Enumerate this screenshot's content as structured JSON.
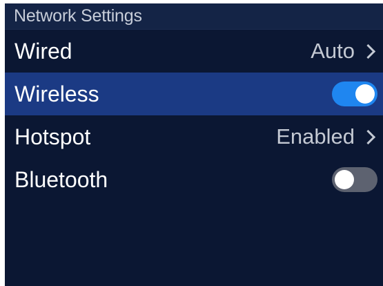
{
  "header": {
    "title": "Network Settings"
  },
  "colors": {
    "background": "#0b1733",
    "header": "#142446",
    "selected": "#1b3a84",
    "toggle_on": "#1f86f0",
    "toggle_off": "#5d6270"
  },
  "menu": {
    "items": [
      {
        "label": "Wired",
        "value": "Auto",
        "control": "chevron-right-icon"
      },
      {
        "label": "Wireless",
        "toggle": "on",
        "selected": true
      },
      {
        "label": "Hotspot",
        "value": "Enabled",
        "control": "chevron-right-icon"
      },
      {
        "label": "Bluetooth",
        "toggle": "off"
      }
    ]
  }
}
